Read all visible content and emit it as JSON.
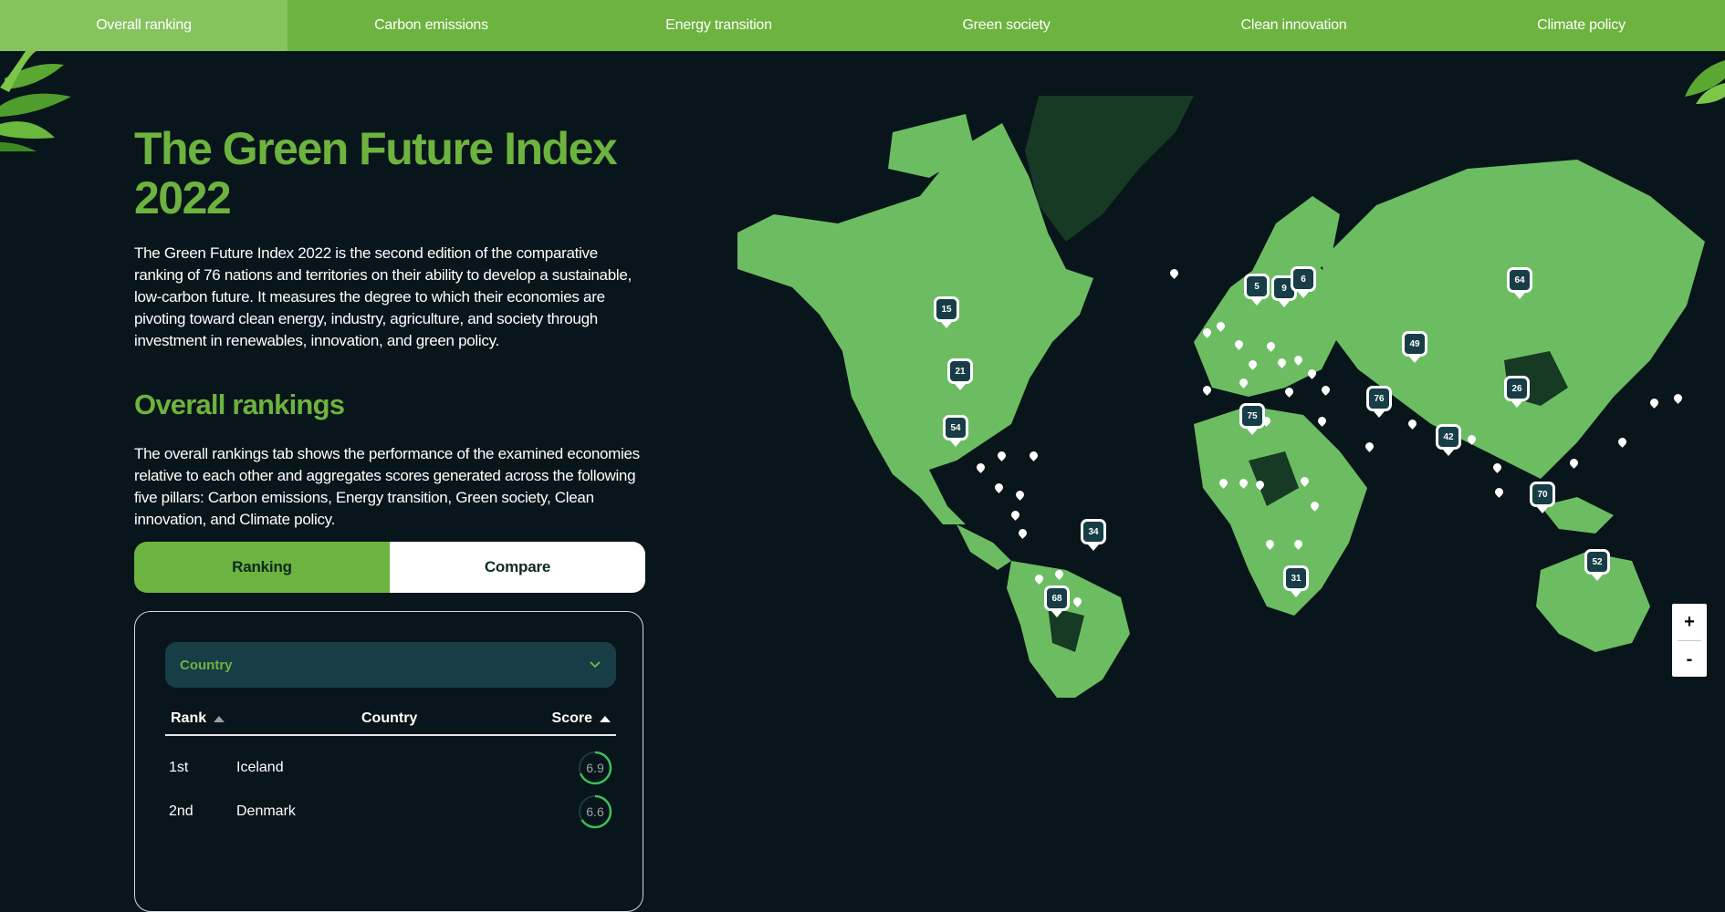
{
  "nav": {
    "tabs": [
      {
        "label": "Overall ranking"
      },
      {
        "label": "Carbon emissions"
      },
      {
        "label": "Energy transition"
      },
      {
        "label": "Green society"
      },
      {
        "label": "Clean innovation"
      },
      {
        "label": "Climate policy"
      }
    ]
  },
  "main": {
    "title": "The Green Future Index 2022",
    "intro": "The Green Future Index 2022 is the second edition of the comparative ranking of 76 nations and territories on their ability to develop a sustainable, low-carbon future. It measures the degree to which their economies are pivoting toward clean energy, industry, agriculture, and society through investment in renewables, innovation, and green policy.",
    "section_title": "Overall rankings",
    "section_desc": "The overall rankings tab shows the performance of the examined economies relative to each other and aggregates scores generated across the following five pillars: Carbon emissions, Energy transition, Green society, Clean innovation, and Climate policy.",
    "toggle": {
      "ranking": "Ranking",
      "compare": "Compare"
    },
    "table": {
      "filter_label": "Country",
      "headers": {
        "rank": "Rank",
        "country": "Country",
        "score": "Score"
      },
      "rows": [
        {
          "rank": "1st",
          "country": "Iceland",
          "score": "6.9",
          "score_fraction": 0.69
        },
        {
          "rank": "2nd",
          "country": "Denmark",
          "score": "6.6",
          "score_fraction": 0.66
        }
      ]
    }
  },
  "map": {
    "markers": [
      "15",
      "21",
      "54",
      "5",
      "9",
      "6",
      "64",
      "49",
      "26",
      "76",
      "75",
      "42",
      "70",
      "34",
      "31",
      "68",
      "52"
    ],
    "zoom_in": "+",
    "zoom_out": "-"
  },
  "colors": {
    "accent": "#6db33f",
    "background": "#08151a",
    "land": "#6cbd62",
    "land_dark": "#163a23",
    "marker": "#173d46"
  }
}
